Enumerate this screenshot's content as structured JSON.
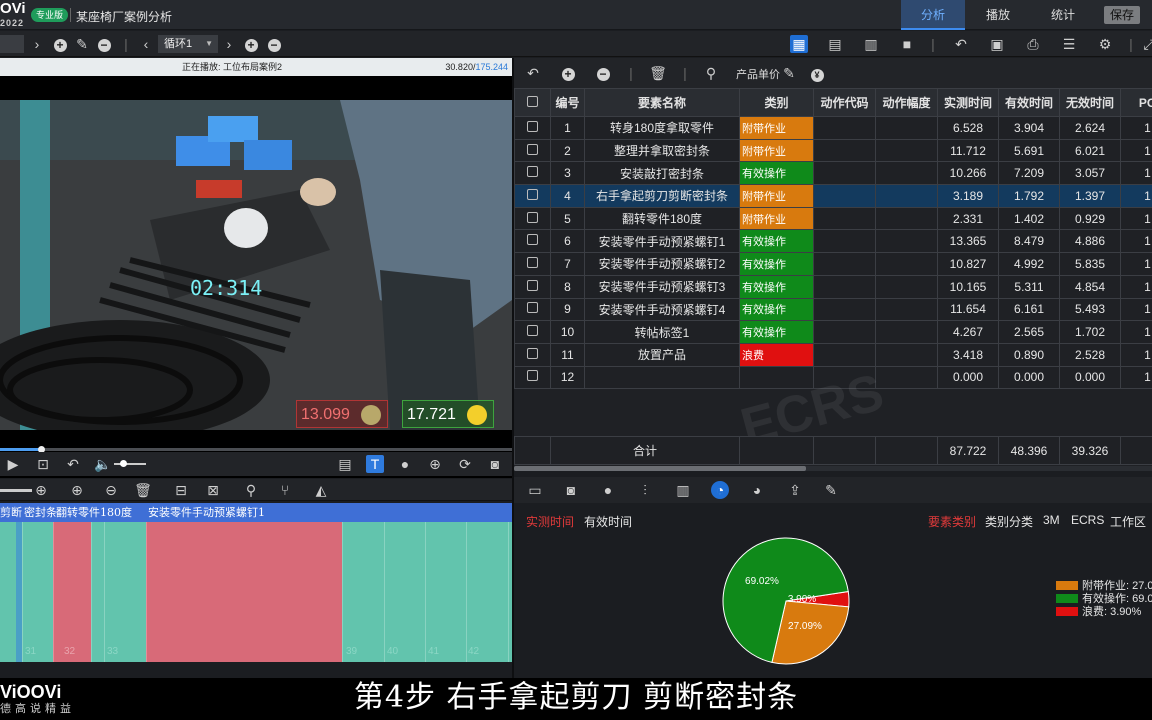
{
  "topbar": {
    "logo": "OVi",
    "year": "2022",
    "badge": "专业版",
    "title": "某座椅厂案例分析",
    "tabs": [
      "分析",
      "播放",
      "统计"
    ],
    "save": "保存"
  },
  "toolbar2": {
    "loop": "循环1"
  },
  "video": {
    "status": "正在播放: 工位布局案例2",
    "time_current": "30.820/",
    "time_total": "175.244",
    "timer": "02:314",
    "bad_value": "13.099",
    "good_value": "17.721",
    "progress": 0.08
  },
  "timeline": {
    "labels": [
      "剪断",
      "密封条",
      "翻转零件180度",
      "安装零件手动预紧螺钉1"
    ],
    "ticks": [
      "31",
      "32",
      "33",
      "39",
      "40",
      "41",
      "42"
    ]
  },
  "table": {
    "price_label": "产品单价",
    "columns": [
      "编号",
      "要素名称",
      "类别",
      "动作代码",
      "动作幅度",
      "实测时间",
      "有效时间",
      "无效时间",
      "PO"
    ],
    "rows": [
      {
        "no": "1",
        "name": "转身180度拿取零件",
        "cat": "附带作业",
        "color": "#d87a0e",
        "t1": "6.528",
        "t2": "3.904",
        "t3": "2.624",
        "po": "1"
      },
      {
        "no": "2",
        "name": "整理并拿取密封条",
        "cat": "附带作业",
        "color": "#d87a0e",
        "t1": "11.712",
        "t2": "5.691",
        "t3": "6.021",
        "po": "1"
      },
      {
        "no": "3",
        "name": "安装敲打密封条",
        "cat": "有效操作",
        "color": "#0f8a1a",
        "t1": "10.266",
        "t2": "7.209",
        "t3": "3.057",
        "po": "1"
      },
      {
        "no": "4",
        "name": "右手拿起剪刀剪断密封条",
        "cat": "附带作业",
        "color": "#d87a0e",
        "t1": "3.189",
        "t2": "1.792",
        "t3": "1.397",
        "po": "1",
        "selected": true
      },
      {
        "no": "5",
        "name": "翻转零件180度",
        "cat": "附带作业",
        "color": "#d87a0e",
        "t1": "2.331",
        "t2": "1.402",
        "t3": "0.929",
        "po": "1"
      },
      {
        "no": "6",
        "name": "安装零件手动预紧螺钉1",
        "cat": "有效操作",
        "color": "#0f8a1a",
        "t1": "13.365",
        "t2": "8.479",
        "t3": "4.886",
        "po": "1"
      },
      {
        "no": "7",
        "name": "安装零件手动预紧螺钉2",
        "cat": "有效操作",
        "color": "#0f8a1a",
        "t1": "10.827",
        "t2": "4.992",
        "t3": "5.835",
        "po": "1"
      },
      {
        "no": "8",
        "name": "安装零件手动预紧螺钉3",
        "cat": "有效操作",
        "color": "#0f8a1a",
        "t1": "10.165",
        "t2": "5.311",
        "t3": "4.854",
        "po": "1"
      },
      {
        "no": "9",
        "name": "安装零件手动预紧螺钉4",
        "cat": "有效操作",
        "color": "#0f8a1a",
        "t1": "11.654",
        "t2": "6.161",
        "t3": "5.493",
        "po": "1"
      },
      {
        "no": "10",
        "name": "转帖标签1",
        "cat": "有效操作",
        "color": "#0f8a1a",
        "t1": "4.267",
        "t2": "2.565",
        "t3": "1.702",
        "po": "1"
      },
      {
        "no": "11",
        "name": "放置产品",
        "cat": "浪费",
        "color": "#e01010",
        "t1": "3.418",
        "t2": "0.890",
        "t3": "2.528",
        "po": "1"
      },
      {
        "no": "12",
        "name": "",
        "cat": "",
        "color": "",
        "t1": "0.000",
        "t2": "0.000",
        "t3": "0.000",
        "po": "1"
      }
    ],
    "total_label": "合计",
    "total_t1": "87.722",
    "total_t2": "48.396",
    "total_t3": "39.326",
    "watermark": "ECRS"
  },
  "chart_panel": {
    "left_tabs": [
      "实测时间",
      "有效时间"
    ],
    "right_tabs": [
      "要素类别",
      "类别分类",
      "3M",
      "ECRS",
      "工作区"
    ]
  },
  "chart_data": {
    "type": "pie",
    "slices": [
      {
        "label": "有效操作",
        "value": 69.02,
        "color": "#0f8a1a",
        "label_text": "69.02%",
        "legend": "有效操作: 69.0"
      },
      {
        "label": "浪费",
        "value": 3.9,
        "color": "#e01010",
        "label_text": "3.90%",
        "legend": "浪费: 3.90%"
      },
      {
        "label": "附带作业",
        "value": 27.09,
        "color": "#d87a0e",
        "label_text": "27.09%",
        "legend": "附带作业: 27.0"
      }
    ],
    "legend_order": [
      2,
      0,
      1
    ]
  },
  "subtitle": "第4步 右手拿起剪刀 剪断密封条",
  "brand": {
    "name": "ViOOVi",
    "slogan": "德高说精益"
  }
}
